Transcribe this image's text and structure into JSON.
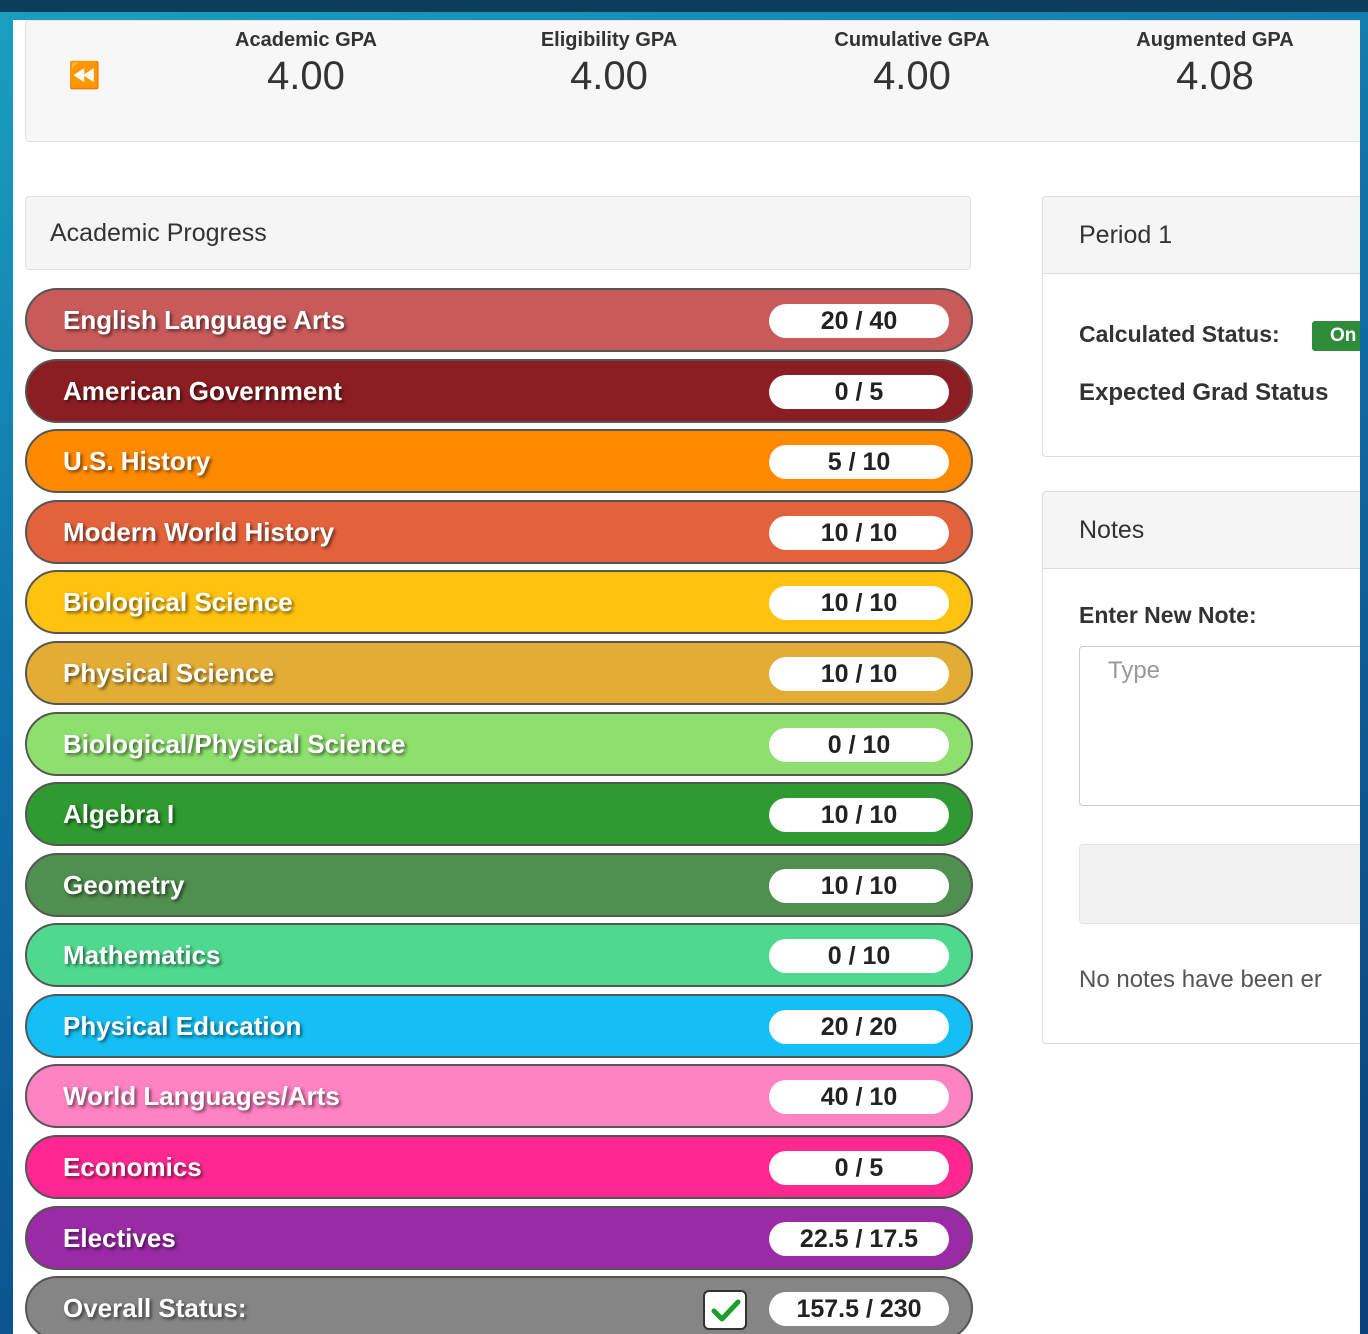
{
  "gpa": [
    {
      "label": "Academic GPA",
      "value": "4.00"
    },
    {
      "label": "Eligibility GPA",
      "value": "4.00"
    },
    {
      "label": "Cumulative GPA",
      "value": "4.00"
    },
    {
      "label": "Augmented GPA",
      "value": "4.08"
    }
  ],
  "academic_progress": {
    "title": "Academic Progress",
    "subjects": [
      {
        "name": "English Language Arts",
        "progress": "20 / 40",
        "color": "#c85a5a"
      },
      {
        "name": "American Government",
        "progress": "0 / 5",
        "color": "#8b1e22"
      },
      {
        "name": "U.S. History",
        "progress": "5 / 10",
        "color": "#ff8a00"
      },
      {
        "name": "Modern World History",
        "progress": "10 / 10",
        "color": "#e2623c"
      },
      {
        "name": "Biological Science",
        "progress": "10 / 10",
        "color": "#ffc30f"
      },
      {
        "name": "Physical Science",
        "progress": "10 / 10",
        "color": "#e3ad35"
      },
      {
        "name": "Biological/Physical Science",
        "progress": "0 / 10",
        "color": "#8ee06e"
      },
      {
        "name": "Algebra I",
        "progress": "10 / 10",
        "color": "#2f9a2f"
      },
      {
        "name": "Geometry",
        "progress": "10 / 10",
        "color": "#4f8f4f"
      },
      {
        "name": "Mathematics",
        "progress": "0 / 10",
        "color": "#4fd98f"
      },
      {
        "name": "Physical Education",
        "progress": "20 / 20",
        "color": "#14bff5"
      },
      {
        "name": "World Languages/Arts",
        "progress": "40 / 10",
        "color": "#ff82c2"
      },
      {
        "name": "Economics",
        "progress": "0 / 5",
        "color": "#ff2890"
      },
      {
        "name": "Electives",
        "progress": "22.5 / 17.5",
        "color": "#9a2aa6"
      }
    ],
    "overall": {
      "label": "Overall Status:",
      "progress": "157.5 / 230",
      "color": "#858585"
    }
  },
  "period": {
    "title": "Period 1",
    "calculated_status_label": "Calculated Status:",
    "calculated_status_value": "On",
    "expected_grad_label": "Expected Grad Status"
  },
  "notes": {
    "title": "Notes",
    "enter_label": "Enter New Note:",
    "placeholder": "Type",
    "empty_text": "No notes have been er"
  }
}
